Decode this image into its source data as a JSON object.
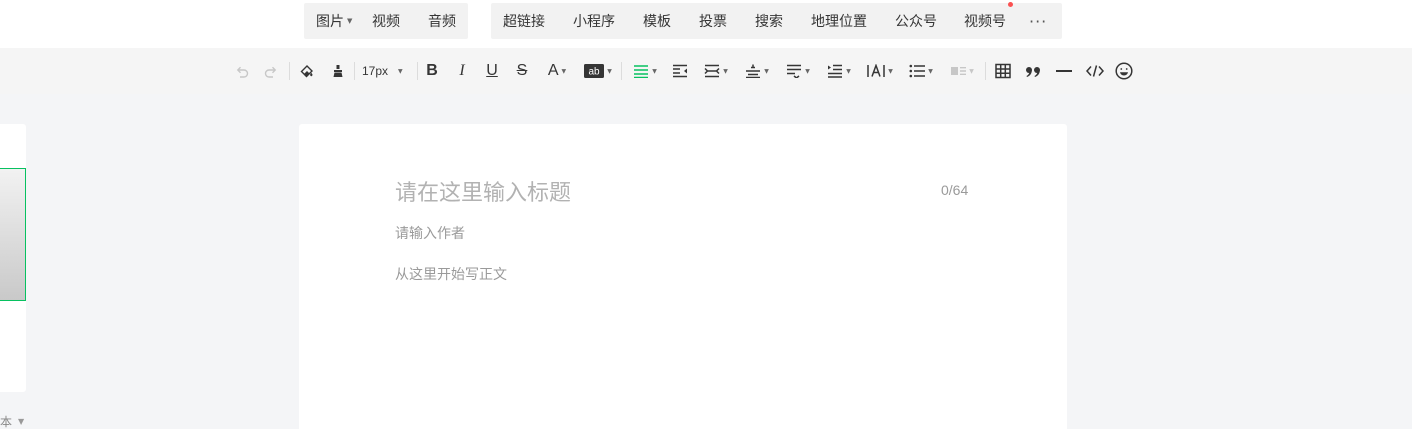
{
  "insert_bar": {
    "group1": [
      {
        "label": "图片",
        "has_dropdown": true
      },
      {
        "label": "视频"
      },
      {
        "label": "音频"
      }
    ],
    "group2": [
      {
        "label": "超链接"
      },
      {
        "label": "小程序"
      },
      {
        "label": "模板"
      },
      {
        "label": "投票"
      },
      {
        "label": "搜索"
      },
      {
        "label": "地理位置"
      },
      {
        "label": "公众号"
      },
      {
        "label": "视频号",
        "new_badge": true
      }
    ],
    "more_label": "···"
  },
  "toolbar": {
    "font_size": "17px",
    "buttons": [
      "undo-icon",
      "redo-icon",
      "format-painter-icon",
      "clear-format-icon",
      "bold-icon",
      "italic-icon",
      "underline-icon",
      "strikethrough-icon",
      "font-color-icon",
      "background-color-icon",
      "align-icon",
      "indent-icon",
      "justify-icon",
      "line-spacing-icon",
      "paragraph-spacing-icon",
      "text-indent-icon",
      "letter-spacing-icon",
      "list-icon",
      "float-icon",
      "table-icon",
      "quote-icon",
      "divider-icon",
      "code-icon",
      "emoji-icon"
    ],
    "align_active_color": "#07c160"
  },
  "left_panel": {
    "label": "本"
  },
  "editor": {
    "title_placeholder": "请在这里输入标题",
    "title_counter": "0/64",
    "author_placeholder": "请输入作者",
    "body_placeholder": "从这里开始写正文"
  },
  "colors": {
    "accent": "#07c160",
    "badge": "#fa5151"
  }
}
